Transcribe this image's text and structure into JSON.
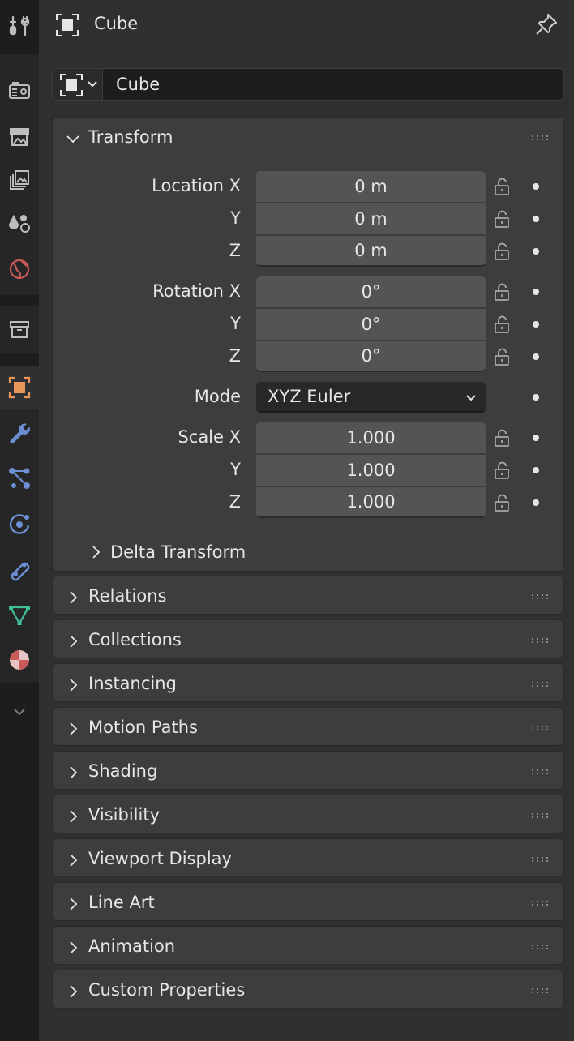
{
  "header": {
    "title": "Cube",
    "icon": "object-icon",
    "pin_icon": "pin-icon"
  },
  "object_selector": {
    "name": "Cube",
    "type_icon": "object-icon"
  },
  "tabs": [
    {
      "name": "tool",
      "icon": "tool-icon"
    },
    {
      "name": "render",
      "icon": "render-icon"
    },
    {
      "name": "output",
      "icon": "output-icon"
    },
    {
      "name": "view-layer",
      "icon": "view-layer-icon"
    },
    {
      "name": "scene",
      "icon": "scene-icon"
    },
    {
      "name": "world",
      "icon": "world-icon"
    },
    {
      "name": "collection",
      "icon": "collection-icon"
    },
    {
      "name": "object",
      "icon": "object-icon",
      "active": true
    },
    {
      "name": "modifiers",
      "icon": "wrench-icon"
    },
    {
      "name": "particles",
      "icon": "particles-icon"
    },
    {
      "name": "physics",
      "icon": "physics-icon"
    },
    {
      "name": "constraints",
      "icon": "constraints-icon"
    },
    {
      "name": "data",
      "icon": "mesh-data-icon"
    },
    {
      "name": "material",
      "icon": "material-icon"
    },
    {
      "name": "more",
      "icon": "chevron-down-icon"
    }
  ],
  "transform": {
    "title": "Transform",
    "location": {
      "label": "Location X",
      "y_label": "Y",
      "z_label": "Z",
      "x": "0 m",
      "y": "0 m",
      "z": "0 m"
    },
    "rotation": {
      "label": "Rotation X",
      "y_label": "Y",
      "z_label": "Z",
      "x": "0°",
      "y": "0°",
      "z": "0°"
    },
    "mode": {
      "label": "Mode",
      "value": "XYZ Euler"
    },
    "scale": {
      "label": "Scale X",
      "y_label": "Y",
      "z_label": "Z",
      "x": "1.000",
      "y": "1.000",
      "z": "1.000"
    },
    "delta": "Delta Transform"
  },
  "panels": [
    "Relations",
    "Collections",
    "Instancing",
    "Motion Paths",
    "Shading",
    "Visibility",
    "Viewport Display",
    "Line Art",
    "Animation",
    "Custom Properties"
  ],
  "colors": {
    "active_accent": "#e8965a",
    "blue_icons": "#6c8fd4",
    "green_icon": "#3fbf9a",
    "red_icon": "#c85a5a"
  }
}
